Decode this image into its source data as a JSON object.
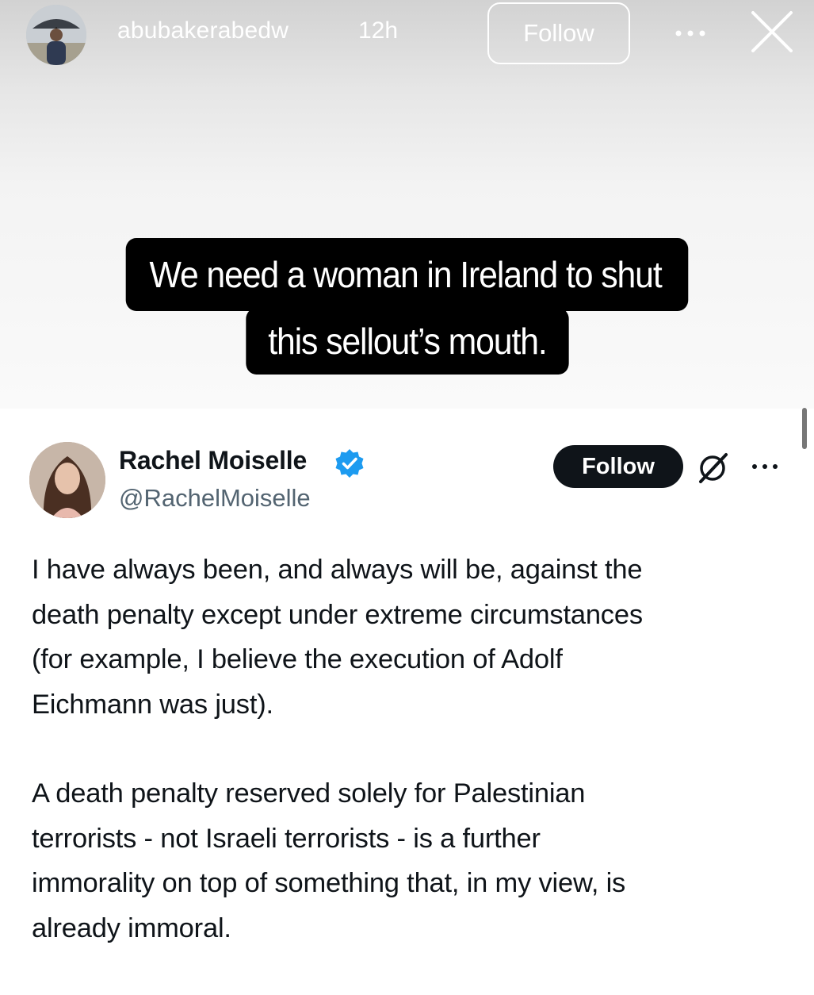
{
  "story": {
    "username": "abubakerabedw",
    "time": "12h",
    "follow_label": "Follow",
    "more_icon": "more-horizontal-icon",
    "close_icon": "close-icon"
  },
  "caption": {
    "line1": "We need a woman in Ireland to shut",
    "line2": "this sellout’s mouth."
  },
  "tweet": {
    "display_name": "Rachel Moiselle",
    "handle": "@RachelMoiselle",
    "verified": true,
    "follow_label": "Follow",
    "grok_icon": "grok-icon",
    "more_icon": "more-horizontal-icon",
    "paragraphs": [
      "I have always been, and always will be, against the\ndeath penalty except under extreme circumstances\n(for example, I believe the execution of Adolf\nEichmann was just).",
      "A death penalty reserved solely for Palestinian\nterrorists - not Israeli terrorists - is a further\nimmorality on top of something that, in my view, is\nalready immoral."
    ]
  },
  "colors": {
    "accent_blue": "#1d9bf0",
    "text_primary": "#0f1419",
    "text_secondary": "#536471"
  }
}
